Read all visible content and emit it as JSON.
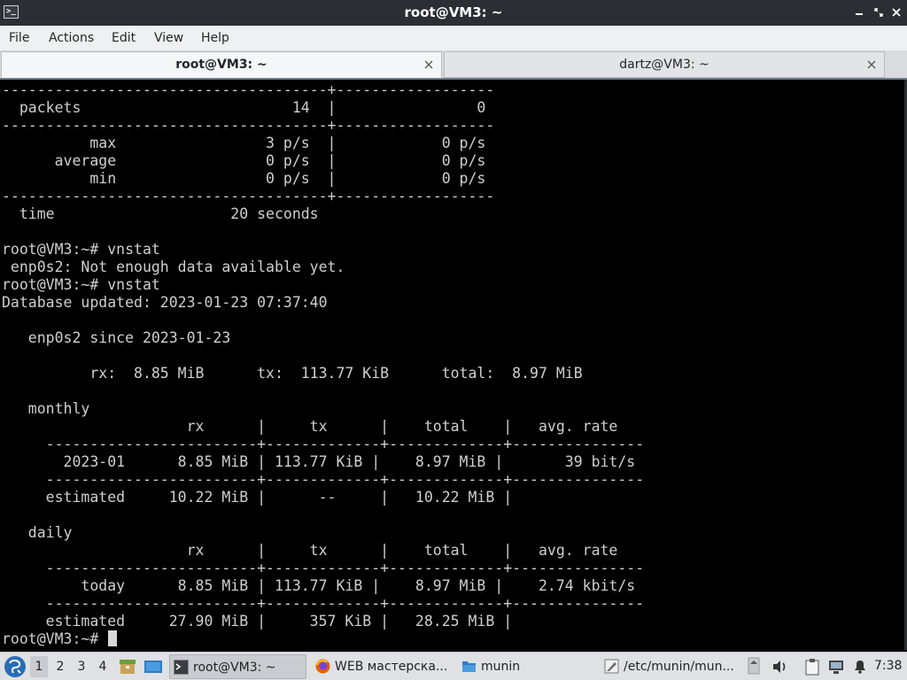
{
  "window": {
    "title": "root@VM3: ~",
    "app_icon": "terminal-icon"
  },
  "menu": [
    "File",
    "Actions",
    "Edit",
    "View",
    "Help"
  ],
  "tabs": [
    {
      "label": "root@VM3: ~",
      "active": true
    },
    {
      "label": "dartz@VM3: ~",
      "active": false
    }
  ],
  "terminal": {
    "lines": [
      "-------------------------------------+------------------",
      "  packets                        14  |                0",
      "-------------------------------------+------------------",
      "          max                 3 p/s  |            0 p/s",
      "      average                 0 p/s  |            0 p/s",
      "          min                 0 p/s  |            0 p/s",
      "-------------------------------------+------------------",
      "  time                    20 seconds",
      "",
      "root@VM3:~# vnstat",
      " enp0s2: Not enough data available yet.",
      "root@VM3:~# vnstat",
      "Database updated: 2023-01-23 07:37:40",
      "",
      "   enp0s2 since 2023-01-23",
      "",
      "          rx:  8.85 MiB      tx:  113.77 KiB      total:  8.97 MiB",
      "",
      "   monthly",
      "                     rx      |     tx      |    total    |   avg. rate",
      "     ------------------------+-------------+-------------+---------------",
      "       2023-01      8.85 MiB | 113.77 KiB |    8.97 MiB |       39 bit/s",
      "     ------------------------+-------------+-------------+---------------",
      "     estimated     10.22 MiB |      --     |   10.22 MiB |",
      "",
      "   daily",
      "                     rx      |     tx      |    total    |   avg. rate",
      "     ------------------------+-------------+-------------+---------------",
      "         today      8.85 MiB | 113.77 KiB |    8.97 MiB |    2.74 kbit/s",
      "     ------------------------+-------------+-------------+---------------",
      "     estimated     27.90 MiB |     357 KiB |   28.25 MiB |",
      "root@VM3:~# "
    ]
  },
  "taskbar": {
    "start_icon": "start-menu-icon",
    "workspaces": [
      "1",
      "2",
      "3",
      "4"
    ],
    "active_workspace": "1",
    "tasks": [
      {
        "label": "root@VM3: ~",
        "icon": "terminal-icon",
        "active": true
      },
      {
        "label": "WEB мастерска...",
        "icon": "firefox-icon",
        "active": false
      },
      {
        "label": "munin",
        "icon": "folder-icon",
        "active": false
      },
      {
        "label": "/etc/munin/mun...",
        "icon": "text-editor-icon",
        "active": false
      }
    ],
    "clock": "7:38"
  }
}
